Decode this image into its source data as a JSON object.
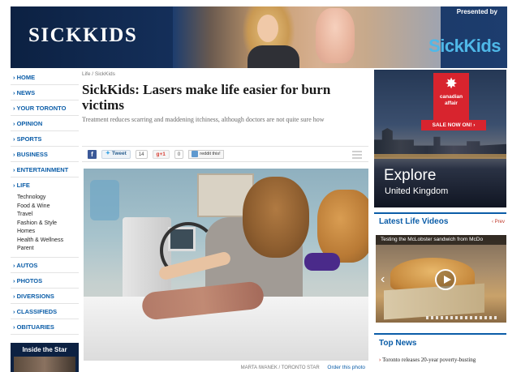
{
  "banner": {
    "title": "SICKKIDS",
    "presented_by": "Presented by",
    "sponsor_logo": "SickKids"
  },
  "nav": {
    "items_top": [
      "HOME",
      "NEWS",
      "YOUR TORONTO",
      "OPINION",
      "SPORTS",
      "BUSINESS",
      "ENTERTAINMENT"
    ],
    "life_label": "LIFE",
    "life_subitems": [
      "Technology",
      "Food & Wine",
      "Travel",
      "Fashion & Style",
      "Homes",
      "Health & Wellness",
      "Parent"
    ],
    "items_bottom": [
      "AUTOS",
      "PHOTOS",
      "DIVERSIONS",
      "CLASSIFIEDS",
      "OBITUARIES"
    ],
    "inside_label": "Inside the Star"
  },
  "article": {
    "breadcrumb": "Life / SickKids",
    "headline": "SickKids: Lasers make life easier for burn victims",
    "dek": "Treatment reduces scarring and maddening itchiness, although doctors are not quite sure how",
    "share": {
      "facebook_icon": "f",
      "tweet_label": "Tweet",
      "tweet_count": "14",
      "gplus_label": "g+1",
      "gplus_count": "0",
      "reddit_label": "reddit this!"
    },
    "photo_credit": "MARTA IWANEK / TORONTO STAR",
    "order_photo": "Order this photo"
  },
  "ad": {
    "brand": "canadian affair",
    "sale": "SALE NOW ON! ›",
    "explore": "Explore",
    "destination": "United Kingdom"
  },
  "latest_videos": {
    "title": "Latest Life Videos",
    "prev_label": "‹ Prev",
    "video_caption": "Testing the McLobster sandwich from McDo"
  },
  "top_news": {
    "title": "Top News",
    "items": [
      "Toronto releases 20-year poverty-busting"
    ]
  },
  "colors": {
    "link_blue": "#0b5da8",
    "banner_navy": "#0c2142",
    "ad_red": "#d8242e"
  }
}
